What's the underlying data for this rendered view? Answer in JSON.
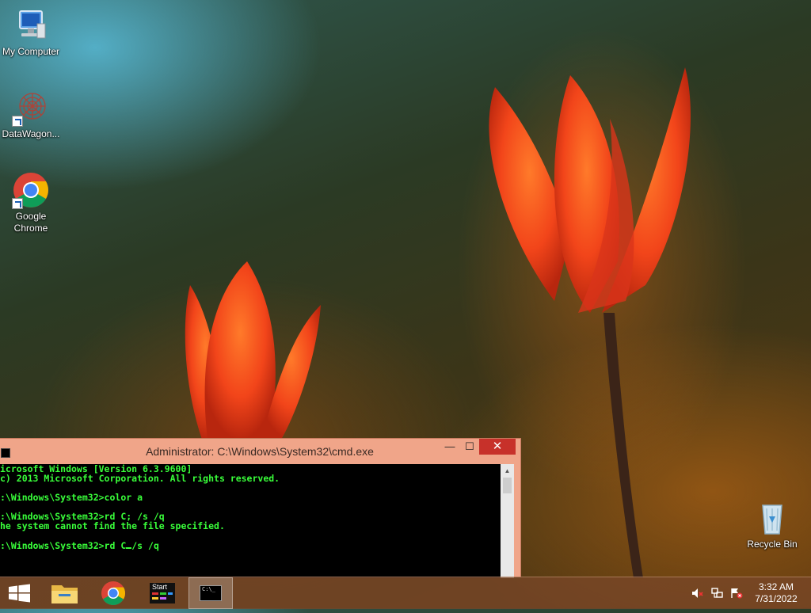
{
  "desktop": {
    "icons": [
      {
        "label": "My Computer",
        "icon": "computer-icon"
      },
      {
        "label": "DataWagon...",
        "icon": "datawagon-icon"
      },
      {
        "label_line1": "Google",
        "label_line2": "Chrome",
        "icon": "chrome-icon"
      },
      {
        "label": "Recycle Bin",
        "icon": "recycle-bin-icon"
      }
    ]
  },
  "cmd_window": {
    "title": "Administrator: C:\\Windows\\System32\\cmd.exe",
    "minimize": "—",
    "maximize": "☐",
    "close": "✕",
    "lines": [
      "icrosoft Windows [Version 6.3.9600]",
      "c) 2013 Microsoft Corporation. All rights reserved.",
      "",
      ":\\Windows\\System32>color a",
      "",
      ":\\Windows\\System32>rd C; /s /q",
      "he system cannot find the file specified.",
      "",
      ":\\Windows\\System32>rd C"
    ],
    "prompt_tail": "/s /q",
    "text_color": "#39ff3a"
  },
  "taskbar": {
    "items": [
      {
        "name": "start-button",
        "icon": "windows-logo-icon"
      },
      {
        "name": "file-explorer",
        "icon": "folder-icon"
      },
      {
        "name": "chrome",
        "icon": "chrome-icon"
      },
      {
        "name": "start-app",
        "icon": "start-app-icon",
        "label": "Start"
      },
      {
        "name": "cmd",
        "icon": "cmd-icon",
        "active": true
      }
    ],
    "tray": {
      "icons": [
        "speaker-muted-icon",
        "network-icon",
        "action-center-flag-icon"
      ],
      "time": "3:32 AM",
      "date": "7/31/2022"
    }
  }
}
